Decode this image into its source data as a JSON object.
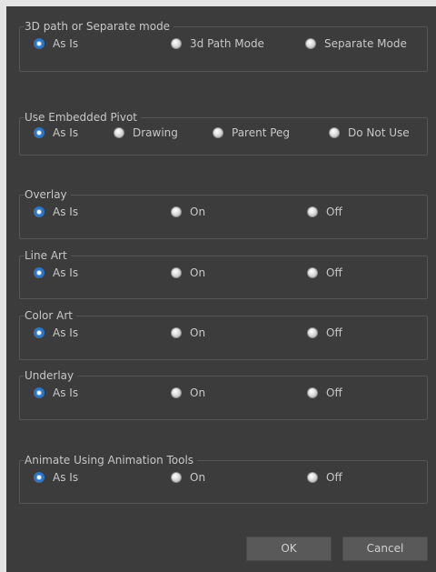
{
  "groups": [
    {
      "title": "3D path or Separate mode",
      "options": [
        "As Is",
        "3d Path Mode",
        "Separate Mode"
      ],
      "selected": 0
    },
    {
      "title": "Use Embedded Pivot",
      "options": [
        "As Is",
        "Drawing",
        "Parent Peg",
        "Do Not Use"
      ],
      "selected": 0
    },
    {
      "title": "Overlay",
      "options": [
        "As Is",
        "On",
        "Off"
      ],
      "selected": 0
    },
    {
      "title": "Line Art",
      "options": [
        "As Is",
        "On",
        "Off"
      ],
      "selected": 0
    },
    {
      "title": "Color Art",
      "options": [
        "As Is",
        "On",
        "Off"
      ],
      "selected": 0
    },
    {
      "title": "Underlay",
      "options": [
        "As Is",
        "On",
        "Off"
      ],
      "selected": 0
    },
    {
      "title": "Animate Using Animation Tools",
      "options": [
        "As Is",
        "On",
        "Off"
      ],
      "selected": 0
    }
  ],
  "buttons": {
    "ok_label": "OK",
    "cancel_label": "Cancel"
  }
}
